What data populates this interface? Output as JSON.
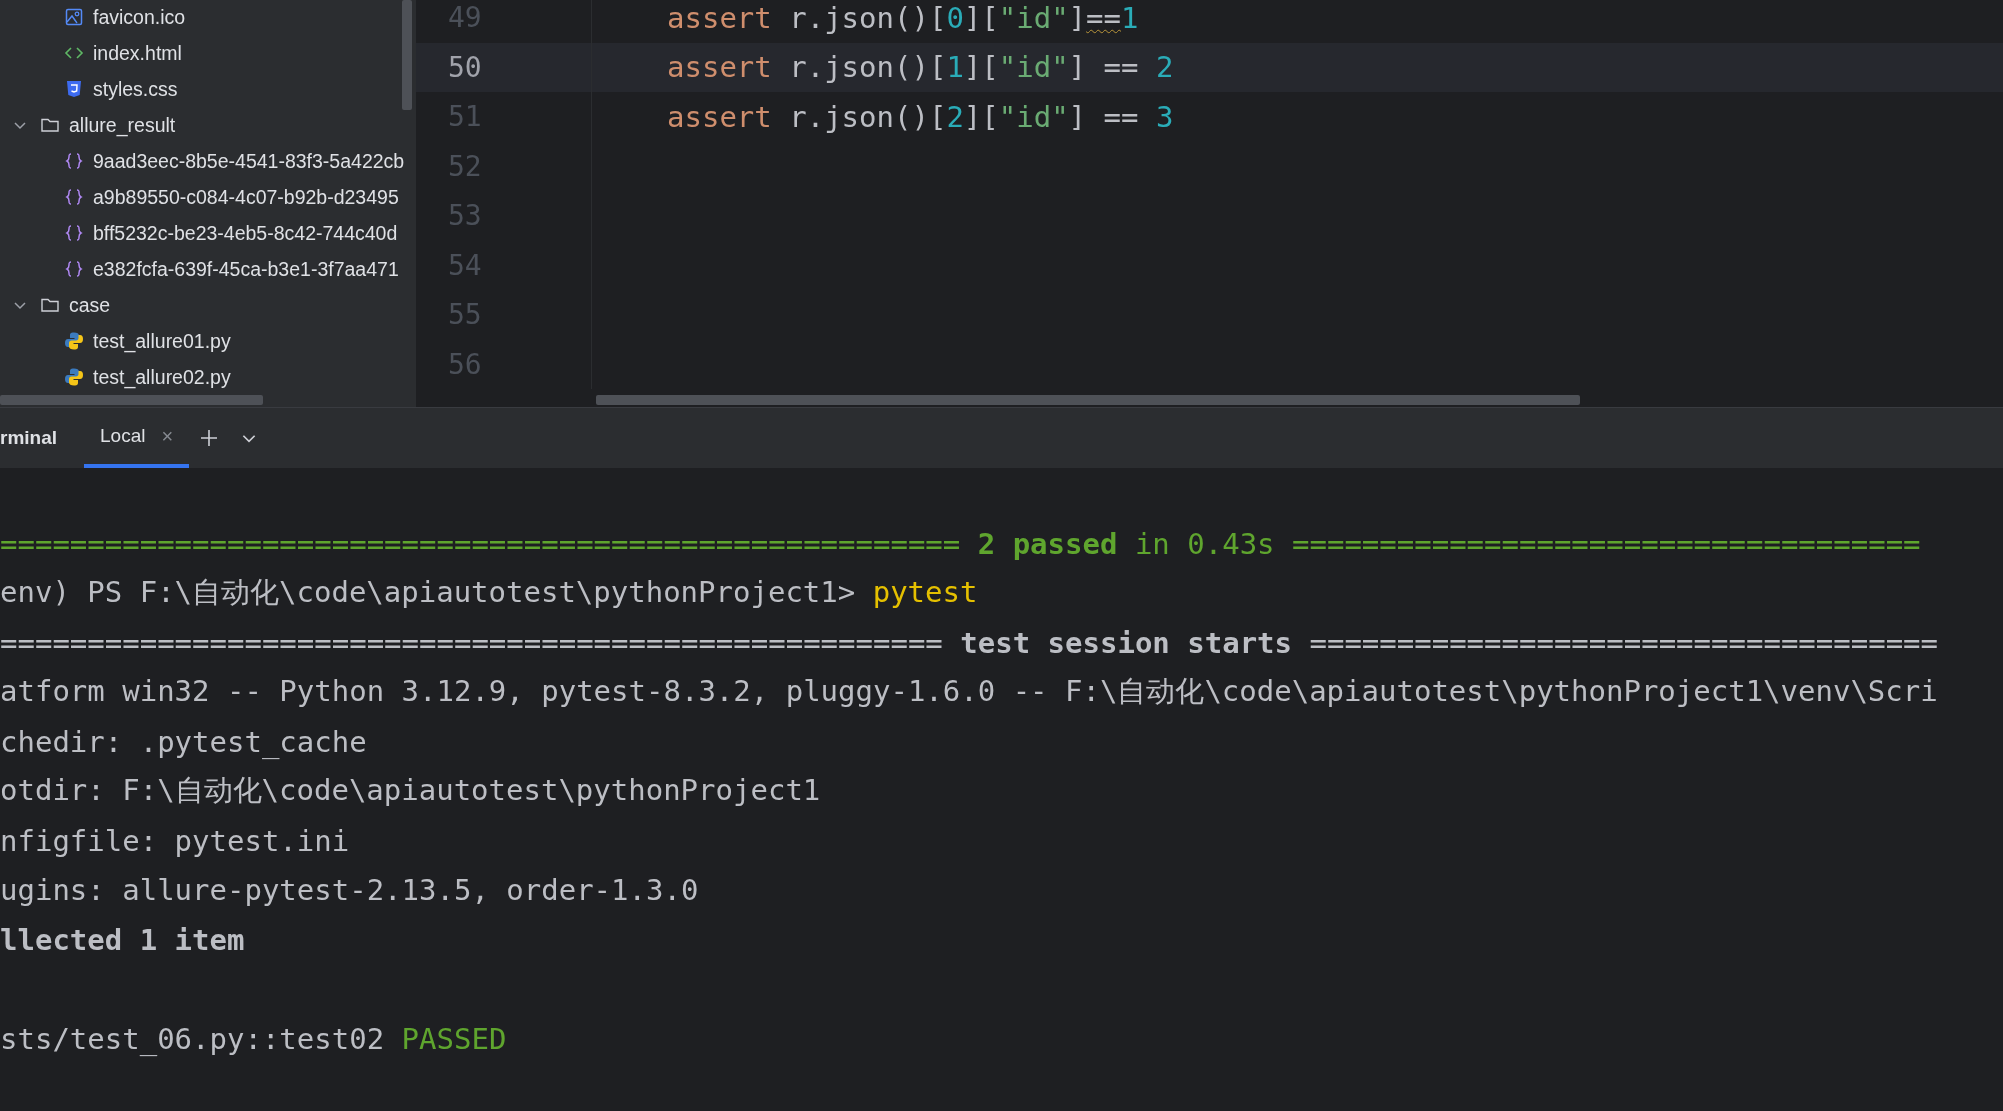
{
  "sidebar": {
    "tree": [
      {
        "kind": "continuation",
        "children": [
          {
            "kind": "image",
            "name": "favicon.ico"
          },
          {
            "kind": "html",
            "name": "index.html"
          },
          {
            "kind": "css",
            "name": "styles.css"
          }
        ]
      },
      {
        "kind": "folder",
        "name": "allure_result",
        "expanded": true,
        "children": [
          {
            "kind": "json",
            "name": "9aad3eec-8b5e-4541-83f3-5a422cb"
          },
          {
            "kind": "json",
            "name": "a9b89550-c084-4c07-b92b-d23495"
          },
          {
            "kind": "json",
            "name": "bff5232c-be23-4eb5-8c42-744c40d"
          },
          {
            "kind": "json",
            "name": "e382fcfa-639f-45ca-b3e1-3f7aa471"
          }
        ]
      },
      {
        "kind": "folder",
        "name": "case",
        "expanded": true,
        "children": [
          {
            "kind": "python",
            "name": "test_allure01.py"
          },
          {
            "kind": "python",
            "name": "test_allure02.py"
          }
        ]
      }
    ]
  },
  "editor": {
    "lines": [
      {
        "number": "49",
        "current": false,
        "tokens": [
          {
            "kind": "keyword",
            "text": "assert"
          },
          {
            "kind": "plain",
            "text": " r.json()["
          },
          {
            "kind": "number",
            "text": "0"
          },
          {
            "kind": "plain",
            "text": "]["
          },
          {
            "kind": "string",
            "text": "\"id\""
          },
          {
            "kind": "plain",
            "text": "]"
          },
          {
            "kind": "plain",
            "text": "==",
            "warning": true
          },
          {
            "kind": "number",
            "text": "1"
          }
        ]
      },
      {
        "number": "50",
        "current": true,
        "tokens": [
          {
            "kind": "keyword",
            "text": "assert"
          },
          {
            "kind": "plain",
            "text": " r.json()["
          },
          {
            "kind": "number",
            "text": "1"
          },
          {
            "kind": "plain",
            "text": "]["
          },
          {
            "kind": "string",
            "text": "\"id\""
          },
          {
            "kind": "plain",
            "text": "] == "
          },
          {
            "kind": "number",
            "text": "2"
          }
        ]
      },
      {
        "number": "51",
        "current": false,
        "tokens": [
          {
            "kind": "keyword",
            "text": "assert"
          },
          {
            "kind": "plain",
            "text": " r.json()["
          },
          {
            "kind": "number",
            "text": "2"
          },
          {
            "kind": "plain",
            "text": "]["
          },
          {
            "kind": "string",
            "text": "\"id\""
          },
          {
            "kind": "plain",
            "text": "] == "
          },
          {
            "kind": "number",
            "text": "3"
          }
        ]
      },
      {
        "number": "52",
        "current": false
      },
      {
        "number": "53",
        "current": false
      },
      {
        "number": "54",
        "current": false
      },
      {
        "number": "55",
        "current": false
      },
      {
        "number": "56",
        "current": false
      }
    ]
  },
  "terminal": {
    "title": "rminal",
    "tabs": [
      {
        "label": "Local",
        "selected": true,
        "close": "×"
      }
    ],
    "lines": [
      {
        "segments": [
          {
            "kind": "result-rule",
            "text": "======================================================= "
          },
          {
            "kind": "result-count",
            "text": "2 passed"
          },
          {
            "kind": "result-rule",
            "text": " in 0.43s ===================================="
          }
        ]
      },
      {
        "segments": [
          {
            "kind": "output",
            "text": "env) PS F:\\自动化\\code\\apiautotest\\pythonProject1> "
          },
          {
            "kind": "command",
            "text": "pytest"
          }
        ]
      },
      {
        "segments": [
          {
            "kind": "output",
            "text": "====================================================== "
          },
          {
            "kind": "heading",
            "text": "test session starts"
          },
          {
            "kind": "output",
            "text": " ===================================="
          }
        ]
      },
      {
        "segments": [
          {
            "kind": "output",
            "text": "atform win32 -- Python 3.12.9, pytest-8.3.2, pluggy-1.6.0 -- F:\\自动化\\code\\apiautotest\\pythonProject1\\venv\\Scri"
          }
        ]
      },
      {
        "segments": [
          {
            "kind": "output",
            "text": "chedir: .pytest_cache"
          }
        ]
      },
      {
        "segments": [
          {
            "kind": "output",
            "text": "otdir: F:\\自动化\\code\\apiautotest\\pythonProject1"
          }
        ]
      },
      {
        "segments": [
          {
            "kind": "output",
            "text": "nfigfile: pytest.ini"
          }
        ]
      },
      {
        "segments": [
          {
            "kind": "output",
            "text": "ugins: allure-pytest-2.13.5, order-1.3.0"
          }
        ]
      },
      {
        "segments": [
          {
            "kind": "heading",
            "text": "llected 1 item"
          }
        ]
      }
    ],
    "results": [
      {
        "segments": [
          {
            "kind": "output",
            "text": "sts/test_06.py::test02 "
          },
          {
            "kind": "status",
            "text": "PASSED"
          }
        ]
      }
    ]
  }
}
